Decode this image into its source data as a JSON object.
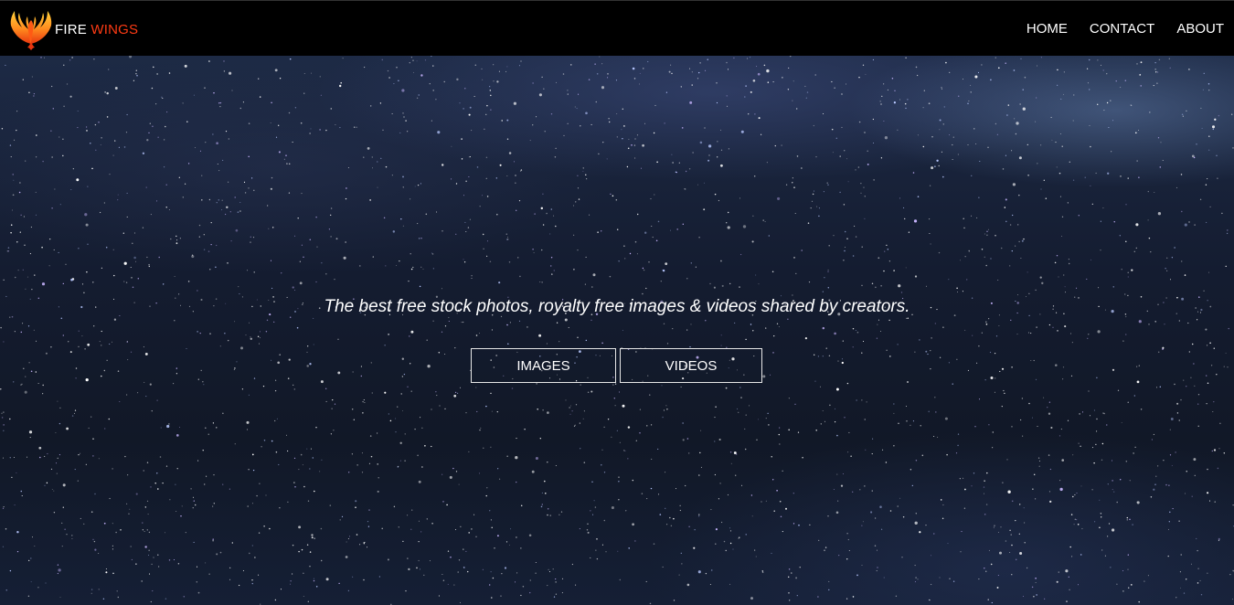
{
  "navbar": {
    "brand": {
      "logo_icon": "phoenix-wings-icon",
      "fire": "FIRE",
      "wings": "WINGS",
      "colors": {
        "fire": "#ffffff",
        "wings": "#ff3b14"
      }
    },
    "links": [
      {
        "label": "HOME"
      },
      {
        "label": "CONTACT"
      },
      {
        "label": "ABOUT"
      }
    ]
  },
  "hero": {
    "background": "starry-night-sky",
    "tagline": "The best free stock photos, royalty free images & videos shared by creators.",
    "buttons": [
      {
        "label": "IMAGES"
      },
      {
        "label": "VIDEOS"
      }
    ]
  }
}
